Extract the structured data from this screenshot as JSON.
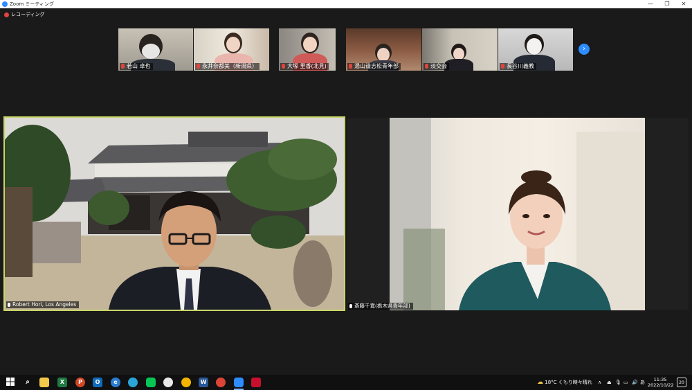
{
  "window": {
    "title": "Zoom ミーティング",
    "controls": {
      "minimize": "—",
      "maximize": "❐",
      "close": "✕"
    }
  },
  "recording": {
    "label": "レコーディング"
  },
  "gallery": {
    "participants": [
      {
        "name": "若山 卓也"
      },
      {
        "name": "永井奈都美（新潟県）"
      },
      {
        "name": "大塚 里香(北見)"
      },
      {
        "name": "湯山谨志松青年部"
      },
      {
        "name": "淡交会"
      },
      {
        "name": "長谷川義教"
      }
    ],
    "next_arrow": "›"
  },
  "main_tiles": {
    "left": {
      "name": "Robert Hori, Los Angeles"
    },
    "right": {
      "name": "斎藤千寛(栃木県青年部)"
    }
  },
  "taskbar": {
    "weather": {
      "temp": "18°C",
      "desc": "くもり時々晴れ"
    },
    "ime": "あ",
    "clock": {
      "time": "11:35",
      "date": "2022/10/22"
    },
    "notifications": "20",
    "tray_arrow": "∧"
  },
  "colors": {
    "zoom_blue": "#2d8cff",
    "active_border": "#c9d66a",
    "muted_red": "#e0443e"
  }
}
